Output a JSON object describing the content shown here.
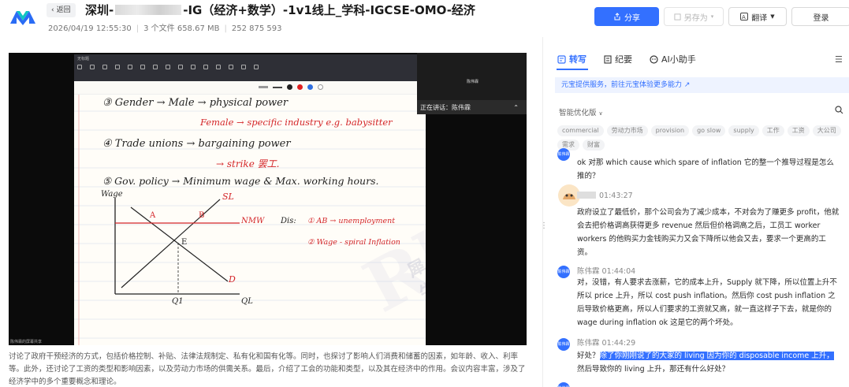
{
  "header": {
    "back_label": "返回",
    "title_prefix": "深圳-",
    "title_suffix": "-IG（经济+数学）-1v1线上_学科-IGCSE-OMO-经济",
    "datetime": "2026/04/19 12:55:30",
    "files": "3 个文件 658.67 MB",
    "views": "252 875 593",
    "share_label": "分享",
    "saveas_label": "另存为",
    "translate_label": "翻译",
    "login_label": "登录"
  },
  "video": {
    "speaking_label": "正在讲话：陈伟霖",
    "thumb_name": "陈伟霖",
    "screen_share_label": "陈伟霖的屏幕共享",
    "watermark": "犀牛国际教育",
    "watermark_big": "Rhew",
    "ipad_title": "无标题"
  },
  "notebook": {
    "line3": "③  Gender  →  Male  →  physical power",
    "line3b": "Female  →  specific industry  e.g. babysitter",
    "line4": "④  Trade unions  →  bargaining power",
    "line4b": "→  strike  罢工.",
    "line5": "⑤  Gov. policy  →  Minimum wage  &  Max. working hours.",
    "graph_y": "Wage",
    "graph_s": "SL",
    "graph_d": "D",
    "graph_nmw": "NMW",
    "graph_a": "A",
    "graph_b": "B",
    "graph_e": "E",
    "graph_q1": "Q1",
    "graph_ql": "QL",
    "dis_label": "Dis:",
    "dis1": "①  AB  →  unemployment",
    "dis2": "②  Wage - spiral  Inflation"
  },
  "summary": "讨论了政府干预经济的方式，包括价格控制、补贴、法律法规制定、私有化和国有化等。同时，也探讨了影响人们消费和储蓄的因素，如年龄、收入、利率等。此外，还讨论了工资的类型和影响因素，以及劳动力市场的供需关系。最后，介绍了工会的功能和类型，以及其在经济中的作用。会议内容丰富，涉及了经济学中的多个重要概念和理论。",
  "panel": {
    "tab_transcribe": "转写",
    "tab_minutes": "纪要",
    "tab_ai": "AI小助手",
    "banner": "元宝提供服务，前往元宝体验更多能力 ↗",
    "smart_label": "智能优化版",
    "keywords_row1": [
      "commercial",
      "劳动力市场",
      "provision",
      "go slow",
      "supply",
      "工作",
      "工资",
      "大公司"
    ],
    "keywords_row2": [
      "需求",
      "财富"
    ],
    "msg0": "ok 对那 which cause which spare of inflation 它的整一个推导过程是怎么推的？",
    "msg1_time": "01:43:27",
    "msg1": "政府设立了最低价，那个公司会为了减少成本，不对会为了赚更多 profit，他就会去把价格调高获得更多 revenue 然后但价格调高之后，工员工 worker workers 的他购买力金钱购买力又会下降所以他会又去，要求一个更高的工资。",
    "msg2_speaker": "陈伟霖",
    "msg2_time": "01:44:04",
    "msg2": "对，没错，有人要求去涨薪，它的成本上升，Supply 就下降，所以位置上升不所以 price 上升，所以 cost push inflation。然后你 cost push inflation 之后导致价格更高，所以人们要求的工资就又高，就一直这样子下去，就是你的 wage during inflation ok 这是它的两个坏处。",
    "msg3_speaker": "陈伟霖",
    "msg3_time": "01:44:29",
    "msg3_pre": "好处？",
    "msg3_hl": "除了你刚刚说了的大家的 living 因为你的 disposable income 上升，",
    "msg3_post": "然后导致你的 living 上升，那还有什么好处？",
    "avatar_label": "陈伟霖"
  },
  "colors": {
    "accent": "#3370ff",
    "ink_black": "#222222",
    "ink_red": "#d4272a"
  }
}
